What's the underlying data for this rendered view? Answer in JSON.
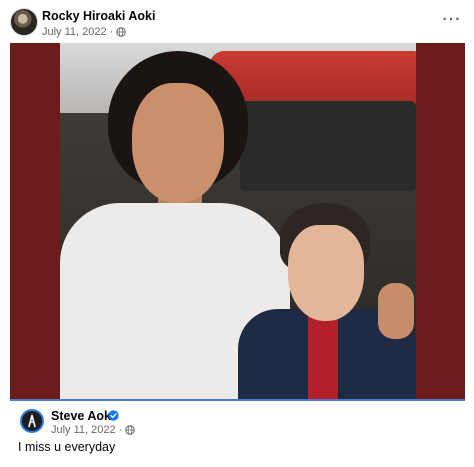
{
  "post": {
    "author": "Rocky Hiroaki Aoki",
    "date": "July 11, 2022",
    "separator": "·",
    "privacy_icon": "globe-icon",
    "more_icon": "more-options-icon",
    "more_label": "···"
  },
  "photo": {
    "background_color": "#6c1c1a"
  },
  "reply": {
    "author": "Steve Aoki",
    "verified_icon": "verified-badge-icon",
    "date": "July 11, 2022",
    "separator": "·",
    "privacy_icon": "globe-icon",
    "text": "I miss u everyday",
    "accent_color": "#4b78c9"
  }
}
